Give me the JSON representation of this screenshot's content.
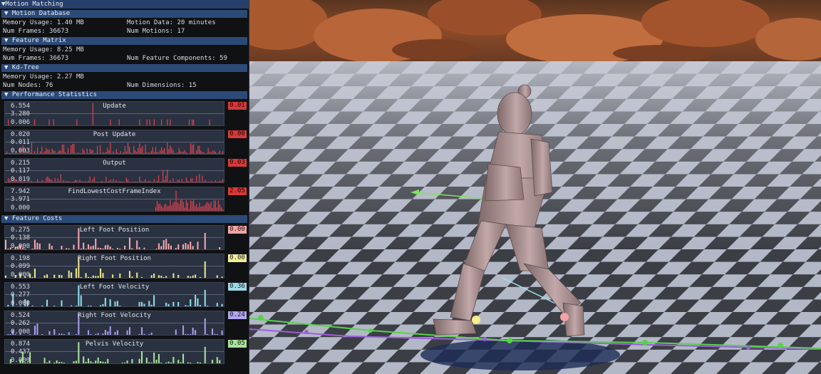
{
  "window": {
    "title": "Motion Matching"
  },
  "motion_database": {
    "header": "Motion Database",
    "memory_usage": "Memory Usage: 1.40 MB",
    "motion_data": "Motion Data: 20 minutes",
    "num_frames": "Num Frames: 36673",
    "num_motions": "Num Motions: 17"
  },
  "feature_matrix": {
    "header": "Feature Matrix",
    "memory_usage": "Memory Usage: 8.25 MB",
    "num_frames": "Num Frames: 36673",
    "num_components": "Num Feature Components: 59"
  },
  "kd_tree": {
    "header": "Kd-Tree",
    "memory_usage": "Memory Usage: 2.27 MB",
    "num_nodes": "Num Nodes: 76",
    "num_dimensions": "Num Dimensions: 15"
  },
  "performance_statistics": {
    "header": "Performance Statistics",
    "plots": [
      {
        "title": "Update",
        "ymax": "6.554",
        "ymid": "3.280",
        "ymin": "0.006",
        "value": "0.01",
        "badge_color": "#d63a3a",
        "bar_color": "#d9434f"
      },
      {
        "title": "Post Update",
        "ymax": "0.020",
        "ymid": "0.011",
        "ymin": "0.003",
        "value": "0.00",
        "badge_color": "#d63a3a",
        "bar_color": "#d9434f"
      },
      {
        "title": "Output",
        "ymax": "0.215",
        "ymid": "0.117",
        "ymin": "0.019",
        "value": "0.03",
        "badge_color": "#d63a3a",
        "bar_color": "#d9434f"
      },
      {
        "title": "FindLowestCostFrameIndex",
        "ymax": "7.942",
        "ymid": "3.971",
        "ymin": "0.000",
        "value": "2.05",
        "badge_color": "#d63a3a",
        "bar_color": "#d9434f"
      }
    ]
  },
  "feature_costs": {
    "header": "Feature Costs",
    "plots": [
      {
        "title": "Left Foot Position",
        "ymax": "0.275",
        "ymid": "0.138",
        "ymin": "0.000",
        "value": "0.00",
        "badge_color": "#f2a3a3",
        "bar_color": "#f4a7b0"
      },
      {
        "title": "Right Foot Position",
        "ymax": "0.198",
        "ymid": "0.099",
        "ymin": "0.000",
        "value": "0.00",
        "badge_color": "#f2ee9a",
        "bar_color": "#ede58a"
      },
      {
        "title": "Left Foot Velocity",
        "ymax": "0.553",
        "ymid": "0.277",
        "ymin": "0.000",
        "value": "0.36",
        "badge_color": "#9adbe8",
        "bar_color": "#8ee0ee"
      },
      {
        "title": "Right Foot Velocity",
        "ymax": "0.524",
        "ymid": "0.262",
        "ymin": "0.000",
        "value": "0.24",
        "badge_color": "#b2a6ee",
        "bar_color": "#a79ef0"
      },
      {
        "title": "Pelvis Velocity",
        "ymax": "0.874",
        "ymid": "0.437",
        "ymin": "0.000",
        "value": "0.05",
        "badge_color": "#a9e39a",
        "bar_color": "#a9e39a"
      }
    ]
  },
  "icons": {
    "collapse": "triangle-down-icon"
  }
}
